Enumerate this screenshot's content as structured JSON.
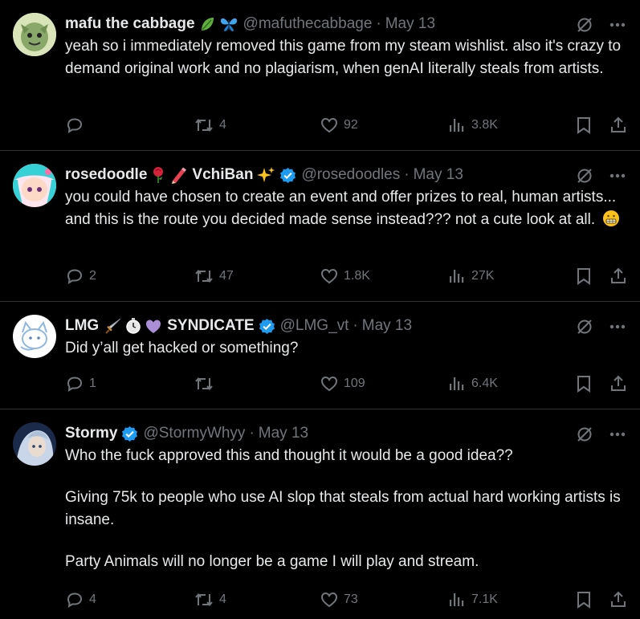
{
  "tweets": [
    {
      "name": "mafu the cabbage",
      "handle": "@mafuthecabbage",
      "sep": "·",
      "date": "May 13",
      "text": [
        "yeah so i immediately removed this game from my steam wishlist. also it's crazy to demand original work and no plagiarism, when genAI literally steals from artists."
      ],
      "replies": "",
      "retweets": "4",
      "likes": "92",
      "views": "3.8K",
      "verified": false
    },
    {
      "name": "rosedoodle",
      "name2": "VchiBan",
      "handle": "@rosedoodles",
      "sep": "·",
      "date": "May 13",
      "text": [
        "you could have chosen to create an event and offer prizes to real, human artists... and this is the route you decided made sense instead??? not a cute look at all."
      ],
      "replies": "2",
      "retweets": "47",
      "likes": "1.8K",
      "views": "27K",
      "verified": true
    },
    {
      "name": "LMG",
      "name2": "SYNDICATE",
      "handle": "@LMG_vt",
      "sep": "·",
      "date": "May 13",
      "text": [
        "Did y’all get hacked or something?"
      ],
      "replies": "1",
      "retweets": "",
      "likes": "109",
      "views": "6.4K",
      "verified": true
    },
    {
      "name": "Stormy",
      "handle": "@StormyWhyy",
      "sep": "·",
      "date": "May 13",
      "text": [
        "Who the fuck approved this and thought it would be a good idea??",
        "Giving 75k to people who use AI slop that steals from actual hard working artists is insane.",
        "Party Animals will no longer be a game I will play and stream."
      ],
      "replies": "4",
      "retweets": "4",
      "likes": "73",
      "views": "7.1K",
      "verified": true
    }
  ],
  "icons": [
    "grok-icon",
    "more-icon",
    "reply-icon",
    "retweet-icon",
    "like-icon",
    "views-icon",
    "bookmark-icon",
    "share-icon"
  ],
  "colors": {
    "background": "#000000",
    "text": "#e7e9ea",
    "muted": "#71767b",
    "verified": "#1d9bf0",
    "divider": "#2f3336"
  }
}
